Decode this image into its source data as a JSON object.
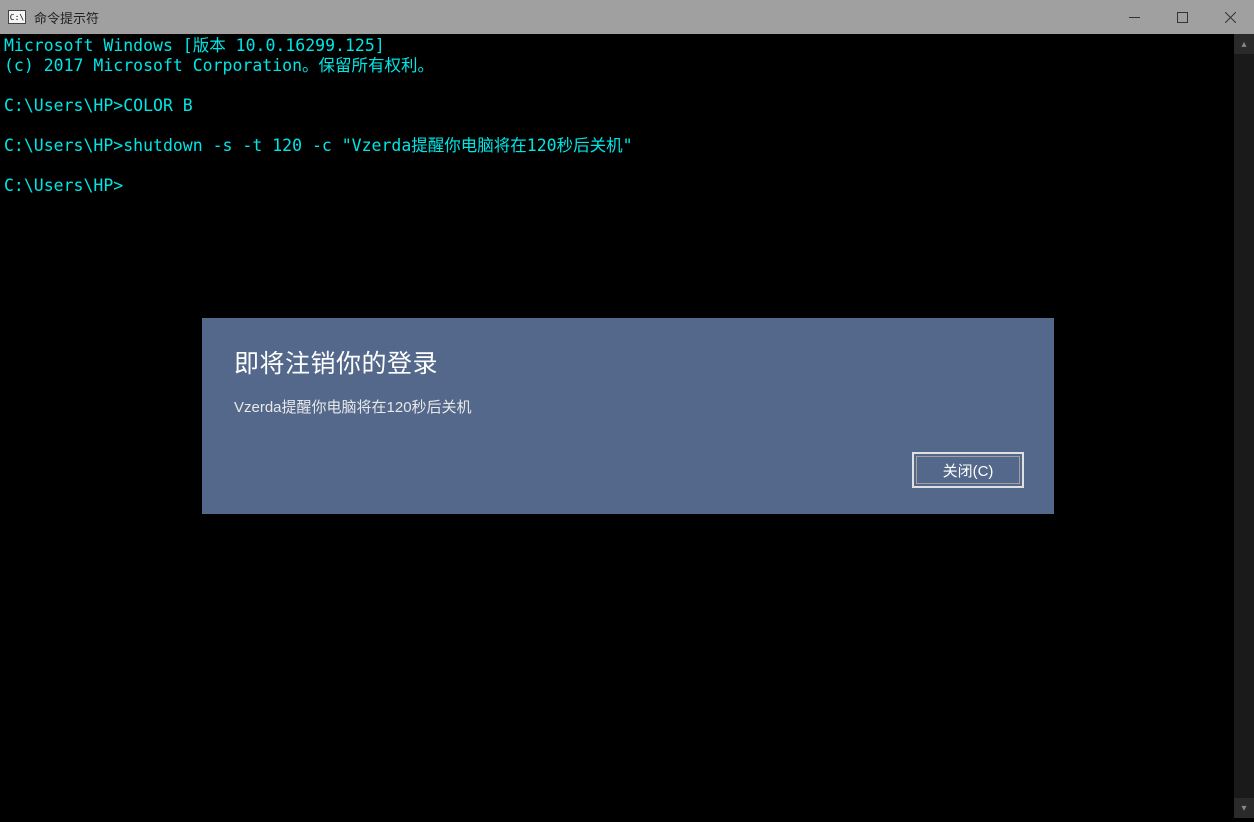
{
  "titlebar": {
    "title": "命令提示符"
  },
  "terminal": {
    "line1": "Microsoft Windows [版本 10.0.16299.125]",
    "line2": "(c) 2017 Microsoft Corporation。保留所有权利。",
    "blank1": "",
    "line3": "C:\\Users\\HP>COLOR B",
    "blank2": "",
    "line4": "C:\\Users\\HP>shutdown -s -t 120 -c \"Vzerda提醒你电脑将在120秒后关机\"",
    "blank3": "",
    "line5": "C:\\Users\\HP>"
  },
  "dialog": {
    "title": "即将注销你的登录",
    "message": "Vzerda提醒你电脑将在120秒后关机",
    "close_button": "关闭(C)"
  },
  "scroll": {
    "up": "▴",
    "down": "▾"
  }
}
